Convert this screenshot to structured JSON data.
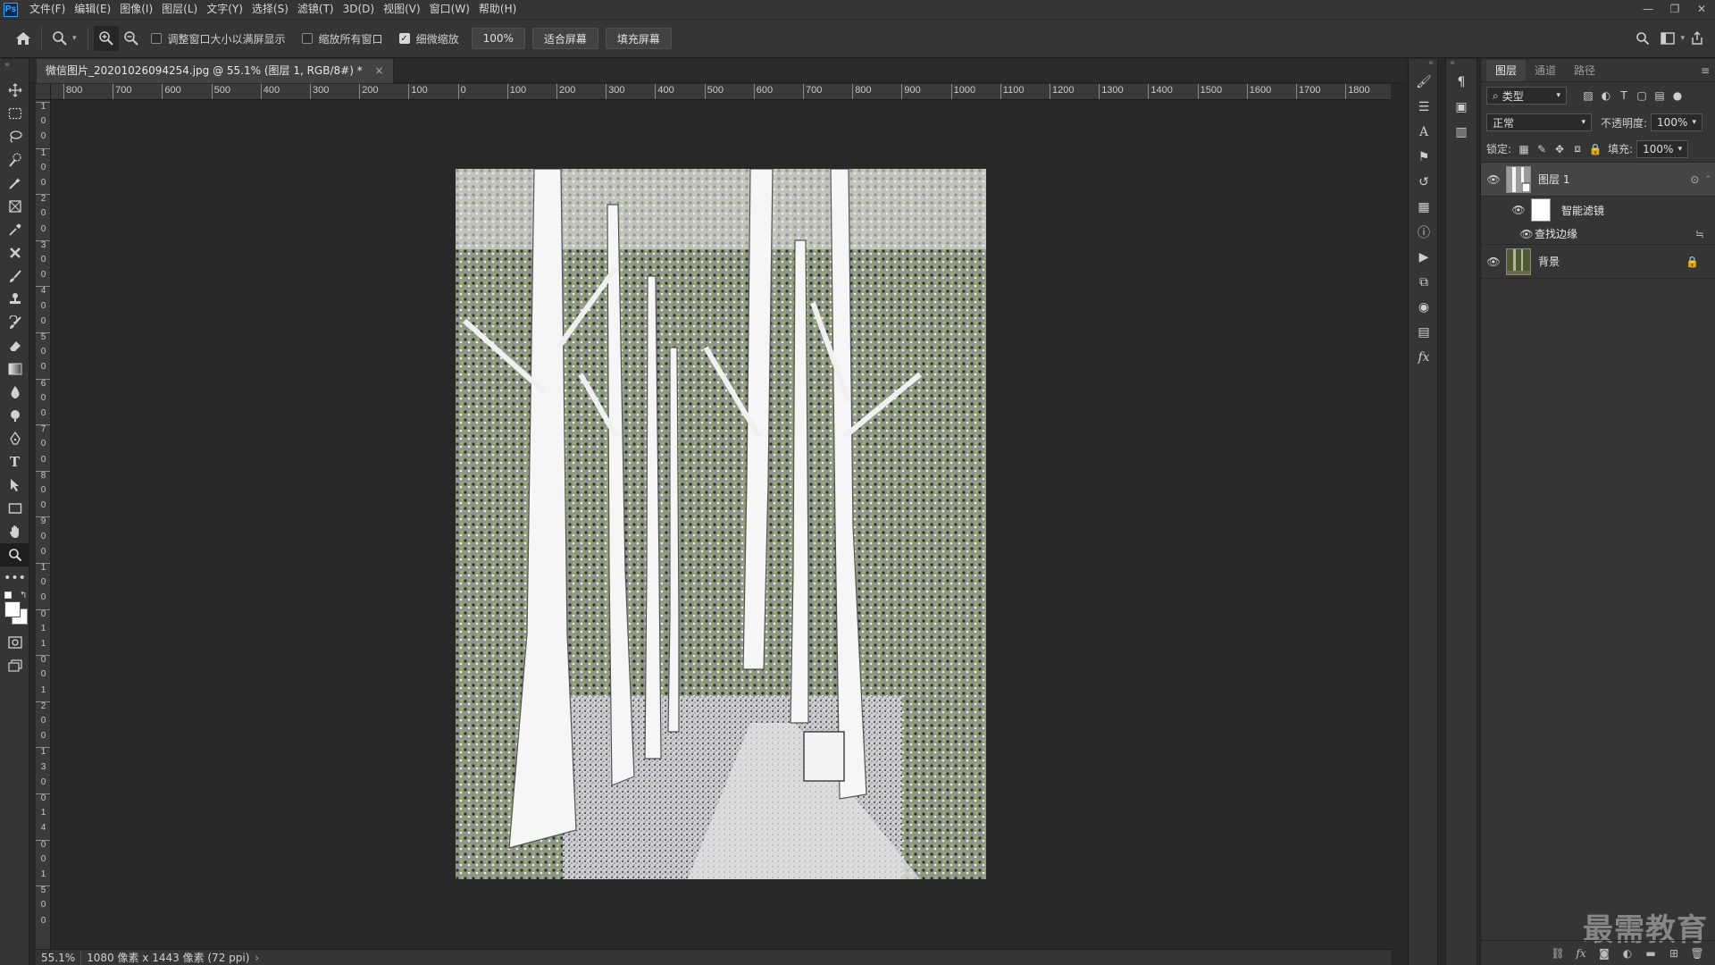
{
  "app": {
    "logo": "Ps"
  },
  "menu": [
    "文件(F)",
    "编辑(E)",
    "图像(I)",
    "图层(L)",
    "文字(Y)",
    "选择(S)",
    "滤镜(T)",
    "3D(D)",
    "视图(V)",
    "窗口(W)",
    "帮助(H)"
  ],
  "window_controls": {
    "minimize": "—",
    "restore": "❐",
    "close": "✕"
  },
  "options": {
    "resize_windows_label": "调整窗口大小以满屏显示",
    "resize_windows_checked": false,
    "zoom_all_label": "缩放所有窗口",
    "zoom_all_checked": false,
    "scrubby_zoom_label": "细微缩放",
    "scrubby_zoom_checked": true,
    "btn_100": "100%",
    "btn_fit": "适合屏幕",
    "btn_fill": "填充屏幕"
  },
  "document": {
    "tab_title": "微信图片_20201026094254.jpg @ 55.1% (图层 1, RGB/8#) *",
    "close": "×"
  },
  "ruler": {
    "h_labels": [
      "800",
      "700",
      "600",
      "500",
      "400",
      "300",
      "200",
      "100",
      "0",
      "100",
      "200",
      "300",
      "400",
      "500",
      "600",
      "700",
      "800",
      "900",
      "1000",
      "1100",
      "1200",
      "1300",
      "1400",
      "1500",
      "1600",
      "1700",
      "1800"
    ],
    "v_labels": [
      "1",
      "0",
      "0",
      "1",
      "0",
      "0",
      "2",
      "0",
      "0",
      "3",
      "0",
      "0",
      "4",
      "0",
      "0",
      "5",
      "0",
      "0",
      "6",
      "0",
      "0",
      "7",
      "0",
      "0",
      "8",
      "0",
      "0",
      "9",
      "0",
      "0",
      "1",
      "0",
      "0",
      "0",
      "1",
      "1",
      "0",
      "0",
      "1",
      "2",
      "0",
      "0",
      "1",
      "3",
      "0",
      "0",
      "1",
      "4",
      "0",
      "0",
      "1",
      "5",
      "0",
      "0"
    ]
  },
  "status": {
    "zoom": "55.1%",
    "info": "1080 像素 x 1443 像素 (72 ppi)"
  },
  "layers_panel": {
    "tabs": [
      "图层",
      "通道",
      "路径"
    ],
    "filter_kind": "类型",
    "blend_mode": "正常",
    "opacity_label": "不透明度:",
    "opacity_value": "100%",
    "lock_label": "锁定:",
    "fill_label": "填充:",
    "fill_value": "100%",
    "layers": [
      {
        "name": "图层 1",
        "selected": true
      },
      {
        "name": "智能滤镜"
      },
      {
        "name": "查找边缘"
      },
      {
        "name": "背景"
      }
    ]
  },
  "watermark": "最需教育",
  "colors": {
    "accent": "#31a8ff",
    "panel": "#353535",
    "canvas": "#282828"
  }
}
